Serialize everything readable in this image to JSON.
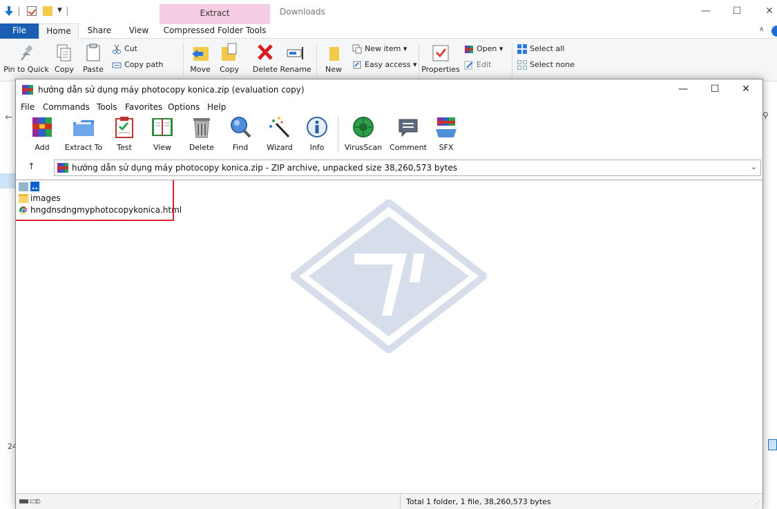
{
  "explorer": {
    "context_tab_label": "Extract",
    "window_title": "Downloads",
    "controls": {
      "minimize": "—",
      "maximize": "☐",
      "close": "✕"
    },
    "tabs": {
      "file": "File",
      "home": "Home",
      "share": "Share",
      "view": "View",
      "compressed": "Compressed Folder Tools"
    },
    "ribbon": {
      "pin": "Pin to Quick",
      "copy": "Copy",
      "paste": "Paste",
      "cut": "Cut",
      "copy_path": "Copy path",
      "move": "Move",
      "copy_to": "Copy",
      "delete": "Delete",
      "rename": "Rename",
      "new": "New",
      "new_item": "New item ▾",
      "easy_access": "Easy access ▾",
      "properties": "Properties",
      "open": "Open ▾",
      "edit": "Edit",
      "select_all": "Select all",
      "select_none": "Select none"
    },
    "status_number": "24",
    "right_letter": "n"
  },
  "rar": {
    "title": "hướng dẫn sử dụng máy photocopy konica.zip (evaluation copy)",
    "controls": {
      "minimize": "—",
      "maximize": "☐",
      "close": "✕"
    },
    "menu": [
      "File",
      "Commands",
      "Tools",
      "Favorites",
      "Options",
      "Help"
    ],
    "toolbar": {
      "add": "Add",
      "extract_to": "Extract To",
      "test": "Test",
      "view": "View",
      "delete": "Delete",
      "find": "Find",
      "wizard": "Wizard",
      "info": "Info",
      "virusscan": "VirusScan",
      "comment": "Comment",
      "sfx": "SFX"
    },
    "address": "hướng dẫn sử dụng máy photocopy konica.zip - ZIP archive, unpacked size 38,260,573 bytes",
    "files": {
      "parent": "..",
      "images": "images",
      "html": "hngdnsdngmyphotocopykonica.html"
    },
    "status": "Total 1 folder, 1 file, 38,260,573 bytes"
  },
  "colors": {
    "accent": "#1a5fb4",
    "highlight": "#e0202a",
    "context_tab": "#f7cde3",
    "selection": "#0a5fd6",
    "watermark": "#d6deeb"
  }
}
